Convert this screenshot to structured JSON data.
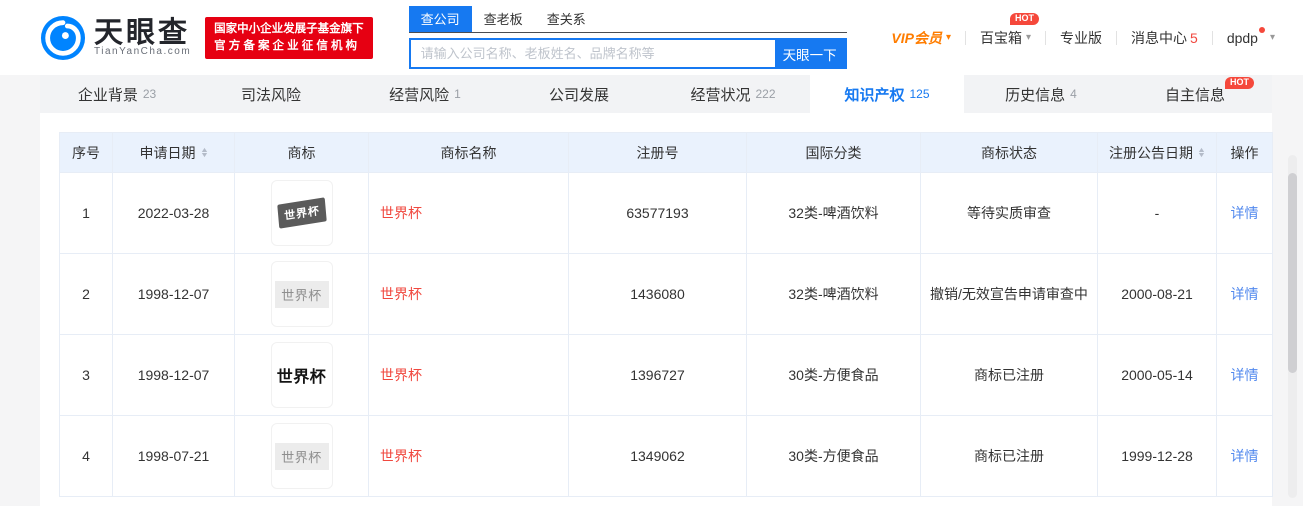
{
  "colors": {
    "accent": "#1679f1",
    "brand_blue": "#0084ff",
    "brand_red": "#e60012",
    "vip_orange": "#ff7d00",
    "hot_red": "#f5483b",
    "link_blue": "#5289ee",
    "name_red": "#f0483f",
    "count_red": "#f0483f"
  },
  "icons": {
    "dropdown_caret": "▾",
    "sort_up": "▲",
    "sort_down": "▼"
  },
  "header": {
    "logo": {
      "title": "天眼查",
      "subtitle": "TianYanCha.com"
    },
    "badge": {
      "line1": "国家中小企业发展子基金旗下",
      "line2": "官方备案企业征信机构"
    },
    "search": {
      "tabs": [
        {
          "label": "查公司",
          "active": true
        },
        {
          "label": "查老板",
          "active": false
        },
        {
          "label": "查关系",
          "active": false
        }
      ],
      "placeholder": "请输入公司名称、老板姓名、品牌名称等",
      "button": "天眼一下"
    },
    "nav": {
      "vip": "VIP会员",
      "toolbox": "百宝箱",
      "toolbox_badge": "HOT",
      "pro": "专业版",
      "messages": "消息中心",
      "messages_count": "5",
      "user": "dpdp"
    }
  },
  "tabs": [
    {
      "label": "企业背景",
      "count": "23",
      "active": false,
      "badge": ""
    },
    {
      "label": "司法风险",
      "count": "",
      "active": false,
      "badge": ""
    },
    {
      "label": "经营风险",
      "count": "1",
      "active": false,
      "badge": ""
    },
    {
      "label": "公司发展",
      "count": "",
      "active": false,
      "badge": ""
    },
    {
      "label": "经营状况",
      "count": "222",
      "active": false,
      "badge": ""
    },
    {
      "label": "知识产权",
      "count": "125",
      "active": true,
      "badge": ""
    },
    {
      "label": "历史信息",
      "count": "4",
      "active": false,
      "badge": ""
    },
    {
      "label": "自主信息",
      "count": "",
      "active": false,
      "badge": "HOT"
    }
  ],
  "table": {
    "columns": [
      {
        "label": "序号",
        "sortable": false
      },
      {
        "label": "申请日期",
        "sortable": true
      },
      {
        "label": "商标",
        "sortable": false
      },
      {
        "label": "商标名称",
        "sortable": false
      },
      {
        "label": "注册号",
        "sortable": false
      },
      {
        "label": "国际分类",
        "sortable": false
      },
      {
        "label": "商标状态",
        "sortable": false
      },
      {
        "label": "注册公告日期",
        "sortable": true
      },
      {
        "label": "操作",
        "sortable": false
      }
    ],
    "action_label": "详情",
    "rows": [
      {
        "index": "1",
        "apply_date": "2022-03-28",
        "mark_style": "flag",
        "mark_text": "世界杯",
        "name": "世界杯",
        "reg_no": "63577193",
        "intl_class": "32类-啤酒饮料",
        "status": "等待实质审查",
        "announce_date": "-"
      },
      {
        "index": "2",
        "apply_date": "1998-12-07",
        "mark_style": "gray",
        "mark_text": "世界杯",
        "name": "世界杯",
        "reg_no": "1436080",
        "intl_class": "32类-啤酒饮料",
        "status": "撤销/无效宣告申请审查中",
        "announce_date": "2000-08-21"
      },
      {
        "index": "3",
        "apply_date": "1998-12-07",
        "mark_style": "black",
        "mark_text": "世界杯",
        "name": "世界杯",
        "reg_no": "1396727",
        "intl_class": "30类-方便食品",
        "status": "商标已注册",
        "announce_date": "2000-05-14"
      },
      {
        "index": "4",
        "apply_date": "1998-07-21",
        "mark_style": "gray",
        "mark_text": "世界杯",
        "name": "世界杯",
        "reg_no": "1349062",
        "intl_class": "30类-方便食品",
        "status": "商标已注册",
        "announce_date": "1999-12-28"
      }
    ]
  }
}
